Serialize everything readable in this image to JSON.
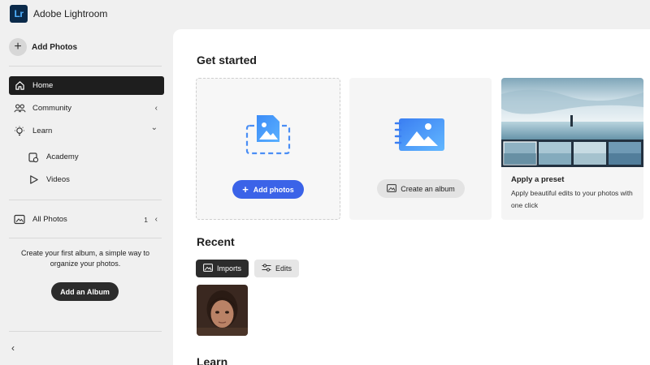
{
  "app": {
    "logo": "Lr",
    "title": "Adobe Lightroom"
  },
  "sidebar": {
    "add_photos": "Add Photos",
    "items": [
      {
        "label": "Home",
        "icon": "home-icon",
        "active": true
      },
      {
        "label": "Community",
        "icon": "community-icon",
        "trail": "‹"
      },
      {
        "label": "Learn",
        "icon": "lightbulb-icon",
        "trail": "⌄"
      },
      {
        "label": "Academy",
        "icon": "academy-icon"
      },
      {
        "label": "Videos",
        "icon": "play-icon"
      },
      {
        "label": "All Photos",
        "icon": "photos-icon",
        "count": "1",
        "trail": "‹"
      }
    ],
    "empty_album_text": "Create your first album, a simple way to organize your photos.",
    "add_album": "Add an Album",
    "collapse": "‹"
  },
  "main": {
    "get_started_title": "Get started",
    "cards": {
      "add_photos_btn": "Add photos",
      "create_album_btn": "Create an album",
      "preset_title": "Apply a preset",
      "preset_desc": "Apply beautiful edits to your photos with one click"
    },
    "recent_title": "Recent",
    "filters": [
      {
        "label": "Imports",
        "icon": "imports-icon",
        "active": true
      },
      {
        "label": "Edits",
        "icon": "sliders-icon",
        "active": false
      }
    ],
    "learn_title": "Learn"
  },
  "colors": {
    "accent_blue": "#3b63e8",
    "active_nav": "#1e1e1e",
    "sidebar_bg": "#f0f0f0",
    "main_bg": "#ffffff"
  }
}
